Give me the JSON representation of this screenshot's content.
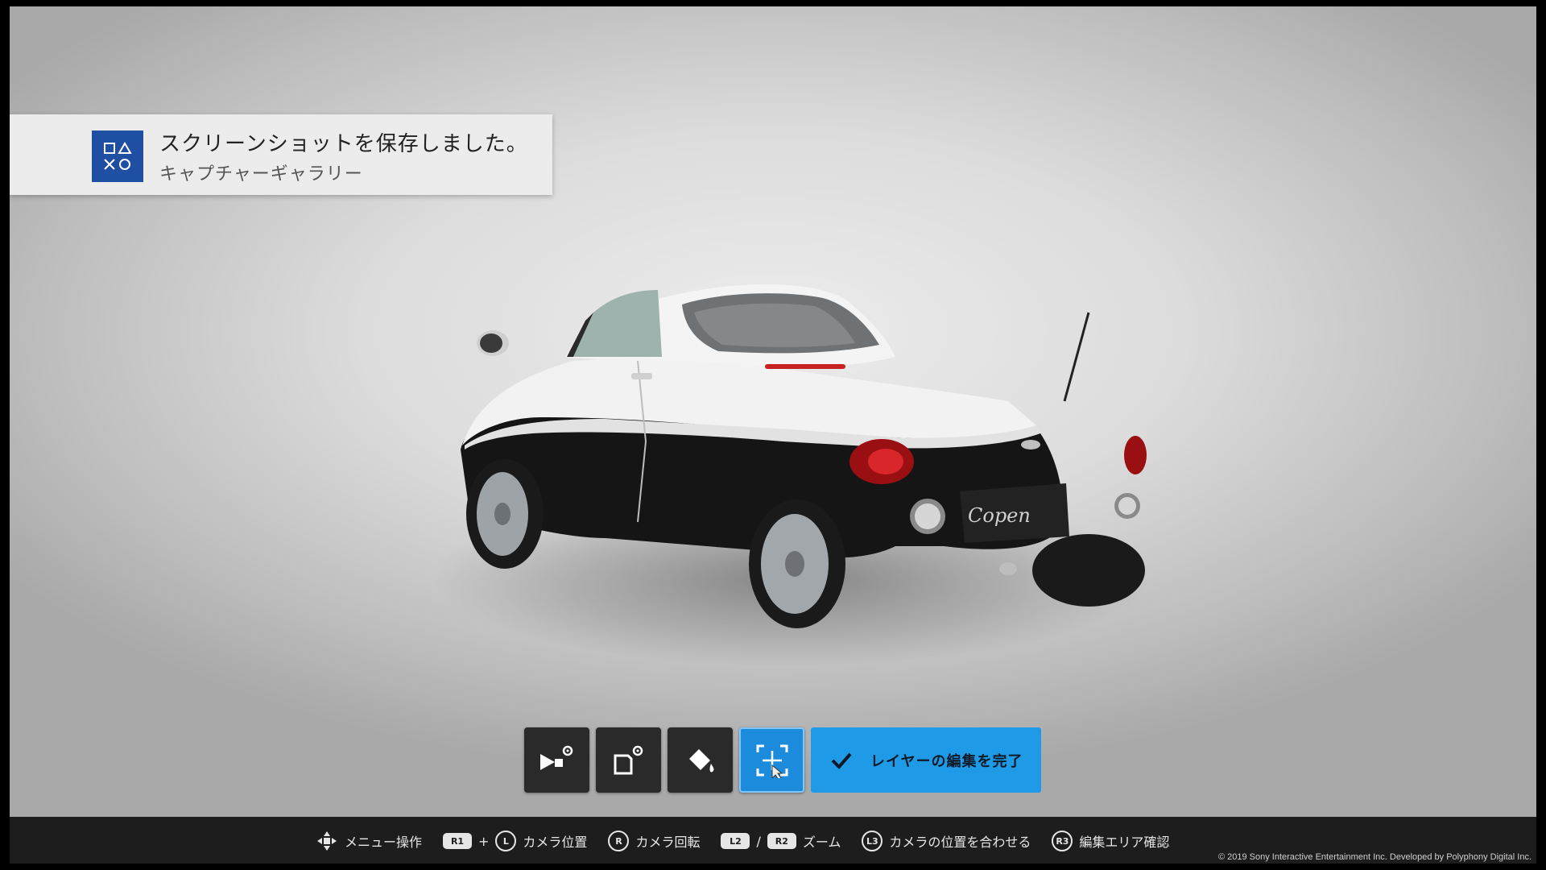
{
  "notification": {
    "title": "スクリーンショットを保存しました。",
    "subtitle": "キャプチャーギャラリー",
    "icon": "playstation-shapes-icon",
    "icon_color": "#1f4fa2"
  },
  "car": {
    "badge": "Copen"
  },
  "toolbar": {
    "buttons": [
      {
        "icon": "video-settings-icon"
      },
      {
        "icon": "layer-settings-icon"
      },
      {
        "icon": "paint-bucket-icon"
      },
      {
        "icon": "move-layer-icon",
        "active": true
      }
    ],
    "finish_label": "レイヤーの編集を完了",
    "accent_color": "#1e9ae6"
  },
  "bottom_bar": {
    "hints": {
      "menu": {
        "icon": "dpad-icon",
        "label": "メニュー操作"
      },
      "camera_position": {
        "button": "R1",
        "plus": "+",
        "stick": "L",
        "label": "カメラ位置"
      },
      "camera_rotate": {
        "stick": "R",
        "label": "カメラ回転"
      },
      "zoom": {
        "button1": "L2",
        "slash": "/",
        "button2": "R2",
        "label": "ズーム"
      },
      "camera_align": {
        "stick": "L3",
        "label": "カメラの位置を合わせる"
      },
      "edit_area": {
        "stick": "R3",
        "label": "編集エリア確認"
      }
    },
    "copyright": "© 2019 Sony Interactive Entertainment Inc. Developed by Polyphony Digital Inc."
  }
}
